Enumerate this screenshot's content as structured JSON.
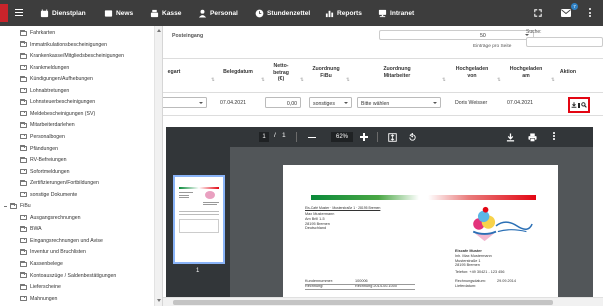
{
  "nav": {
    "items": [
      {
        "label": "Dienstplan",
        "icon": "calendar-icon"
      },
      {
        "label": "News",
        "icon": "newspaper-icon"
      },
      {
        "label": "Kasse",
        "icon": "cash-register-icon"
      },
      {
        "label": "Personal",
        "icon": "user-icon"
      },
      {
        "label": "Stundenzettel",
        "icon": "clock-icon"
      },
      {
        "label": "Reports",
        "icon": "chart-icon"
      },
      {
        "label": "Intranet",
        "icon": "network-icon"
      }
    ],
    "mail_badge": "7"
  },
  "sidebar": {
    "items": [
      "Fahrkarten",
      "Immatrikulationsbescheinigungen",
      "Krankenkasse/Mitgliedsbescheinigungen",
      "Krankmeldungen",
      "Kündigungen/Aufhebungen",
      "Lohnabtretungen",
      "Lohnsteuerbescheinigungen",
      "Meldebescheinigungen (SV)",
      "Mitarbeiterdarlehen",
      "Personalbogen",
      "Pfändungen",
      "RV-Befreiungen",
      "Sofortmeldungen",
      "Zertifizierungen/Fortbildungen",
      "sonstige Dokumente"
    ],
    "fibu_label": "FiBu",
    "fibu_items": [
      "Ausgangsrechnungen",
      "BWA",
      "Eingangsrechnungen und Avise",
      "Inventur und Bruchlisten",
      "Kassenbelege",
      "Kontoauszüge / Saldenbestätigungen",
      "Lieferscheine",
      "Mahnungen"
    ]
  },
  "main": {
    "title": "Posteingang",
    "per_page_value": "50",
    "per_page_label": "Einträge pro Seite",
    "search_label": "Suche:",
    "columns": {
      "kategorie": "egart",
      "belegdatum": "Belegdatum",
      "nettobetrag": "Netto-\nbetrag\n(€)",
      "zuordnung_fibu": "Zuordnung\nFiBu",
      "zuordnung_mitarbeiter": "Zuordnung\nMitarbeiter",
      "hochgeladen_von": "Hochgeladen\nvon",
      "hochgeladen_am": "Hochgeladen\nam",
      "aktion": "Aktion"
    },
    "row": {
      "belegdatum": "07.04.2021",
      "nettobetrag": "0,00",
      "fibu": "sonstiges",
      "mitarbeiter": "Bitte wählen",
      "von": "Doris Weisser",
      "am": "07.04.2021"
    }
  },
  "pdf": {
    "page_current": "1",
    "page_sep": "/",
    "page_total": "1",
    "zoom": "62%",
    "thumb_label": "1",
    "sender_line": "Eis-Café Muster · Musterstraße 1 · 28195 Bremen",
    "recipient": [
      "Max Mustermann",
      "Am Brill 1-5",
      "28195 Bremen",
      "Deutschland"
    ],
    "company": [
      "Eiscafe Muster",
      "Inh. Max Mustermann",
      "Musterstraße 1",
      "28195 Bremen"
    ],
    "phone": "Telefon: +49 30421 - 123 456",
    "fields": [
      [
        "Kundennummer:",
        "100006"
      ],
      [
        "Rechnung:",
        "Rechnung 2014-00-1000"
      ]
    ],
    "date_fields": [
      [
        "Rechnungsdatum:",
        "29.09.2014"
      ],
      [
        "Lieferdatum:",
        ""
      ]
    ],
    "accent_colors": {
      "red": "#e30613",
      "green": "#0a8a3a"
    }
  }
}
